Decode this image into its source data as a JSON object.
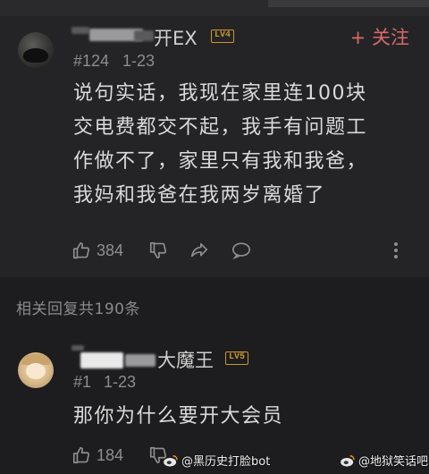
{
  "comment1": {
    "username_suffix": "开EX",
    "level": "LV4",
    "follow_label": "+ 关注",
    "floor": "#124",
    "date": "1-23",
    "lines": [
      "说句实话，我现在家里连100块",
      "交电费都交不起，我手有问题工",
      "作做不了，家里只有我和我爸，",
      "我妈和我爸在我两岁离婚了"
    ],
    "likes": "384",
    "icons": [
      "thumb-up-icon",
      "thumb-down-icon",
      "share-icon",
      "comment-icon",
      "more-icon"
    ]
  },
  "replies_label": "相关回复共190条",
  "comment2": {
    "username_suffix": "大魔王",
    "level": "LV5",
    "floor": "#1",
    "date": "1-23",
    "lines": [
      "那你为什么要开大会员"
    ],
    "likes": "184"
  },
  "watermarks": [
    "@黑历史打脸bot",
    "@地狱笑话吧"
  ],
  "colors": {
    "follow": "#d9686b",
    "badge": "#c9962a",
    "background": "#1d1d1f",
    "card": "#242426"
  }
}
